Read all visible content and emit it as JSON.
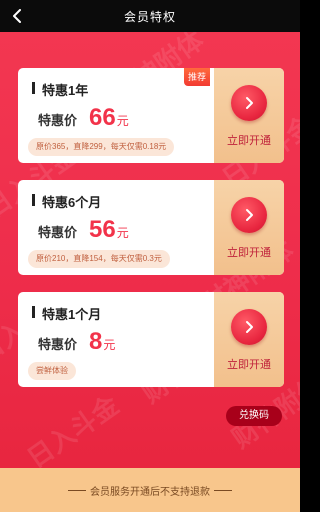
{
  "nav": {
    "title": "会员特权"
  },
  "watermark": {
    "phrases": [
      "日入斗金",
      "财神附体",
      "日入斗金",
      "财神附体",
      "日入斗金",
      "财神附体",
      "日入斗金",
      "财神附体"
    ]
  },
  "plans": [
    {
      "name": "特惠1年",
      "price_label": "特惠价",
      "price": "66",
      "unit": "元",
      "note": "原价365，直降299，每天仅需0.18元",
      "badge": "推荐",
      "buy_label": "立即开通"
    },
    {
      "name": "特惠6个月",
      "price_label": "特惠价",
      "price": "56",
      "unit": "元",
      "note": "原价210，直降154，每天仅需0.3元",
      "buy_label": "立即开通"
    },
    {
      "name": "特惠1个月",
      "price_label": "特惠价",
      "price": "8",
      "unit": "元",
      "note": "尝鲜体验",
      "buy_label": "立即开通"
    }
  ],
  "redeem": {
    "label": "兑换码"
  },
  "footer": {
    "text": "会员服务开通后不支持退款"
  },
  "colors": {
    "background_red": "#ee2d4b",
    "price_red": "#f2334a",
    "button_gold": "#f2c08c",
    "footer_gold": "#f8c68c"
  },
  "icons": {
    "back": "back-chevron-icon",
    "buy": "chevron-right-icon"
  }
}
